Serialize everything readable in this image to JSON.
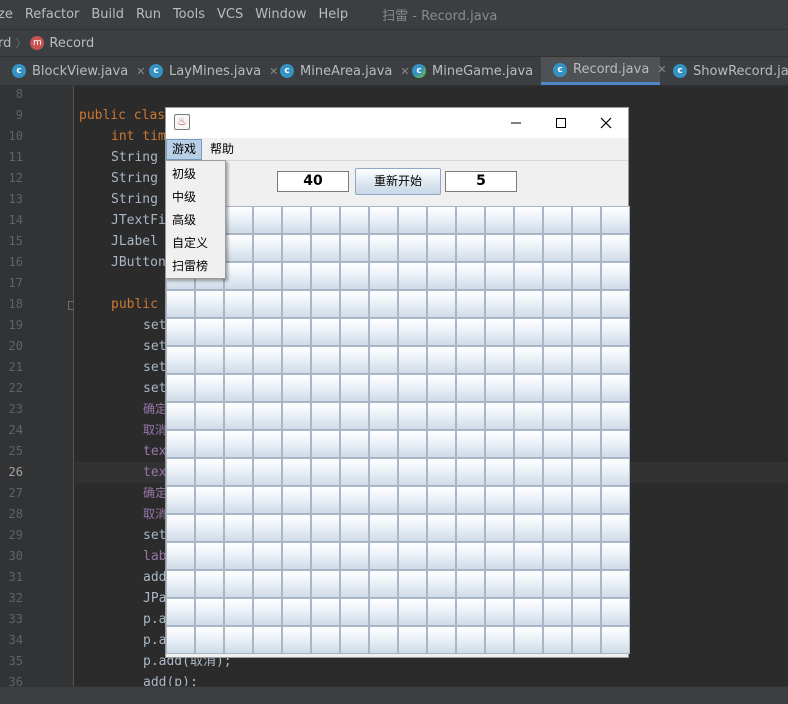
{
  "ide": {
    "menu": [
      "ze",
      "Refactor",
      "Build",
      "Run",
      "Tools",
      "VCS",
      "Window",
      "Help"
    ],
    "window_title": "扫雷 - Record.java",
    "breadcrumb": {
      "project": "rd",
      "class_icon": "m",
      "class": "Record"
    },
    "tabs": [
      {
        "label": "BlockView.java",
        "icon": "class-icon",
        "active": false
      },
      {
        "label": "LayMines.java",
        "icon": "class-icon",
        "active": false
      },
      {
        "label": "MineArea.java",
        "icon": "class-icon",
        "active": false
      },
      {
        "label": "MineGame.java",
        "icon": "runnable-class-icon",
        "active": false
      },
      {
        "label": "Record.java",
        "icon": "class-icon",
        "active": true
      },
      {
        "label": "ShowRecord.java",
        "icon": "class-icon",
        "active": false
      }
    ],
    "line_numbers": [
      "8",
      "9",
      "10",
      "11",
      "12",
      "13",
      "14",
      "15",
      "16",
      "17",
      "18",
      "19",
      "20",
      "21",
      "22",
      "23",
      "24",
      "25",
      "26",
      "27",
      "28",
      "29",
      "30",
      "31",
      "32",
      "33",
      "34",
      "35",
      "36"
    ],
    "current_line": "26",
    "code": {
      "l9": "public clas",
      "l10": "int tim",
      "l11": "String",
      "l12": "String",
      "l13": "String",
      "l14": "JTextFi",
      "l15": "JLabel",
      "l16": "JButton",
      "l18": "public",
      "l19": "set",
      "l20": "set",
      "l21": "set",
      "l22": "set",
      "l23": "确定",
      "l24": "取消",
      "l25": "tex",
      "l26": "tex",
      "l27": "确定",
      "l28": "取消",
      "l29": "set",
      "l30": "lab",
      "l31": "add",
      "l32": "JPa",
      "l33": "p.a",
      "l34": "p.a",
      "l35": "p.add(取消);",
      "l36": "add(p);"
    }
  },
  "game": {
    "menus": [
      "游戏",
      "帮助"
    ],
    "game_menu_items": [
      "初级",
      "中级",
      "高级",
      "自定义",
      "扫雷榜"
    ],
    "mine_count": "40",
    "restart_label": "重新开始",
    "timer": "5",
    "grid": {
      "rows": 16,
      "cols": 16
    }
  }
}
